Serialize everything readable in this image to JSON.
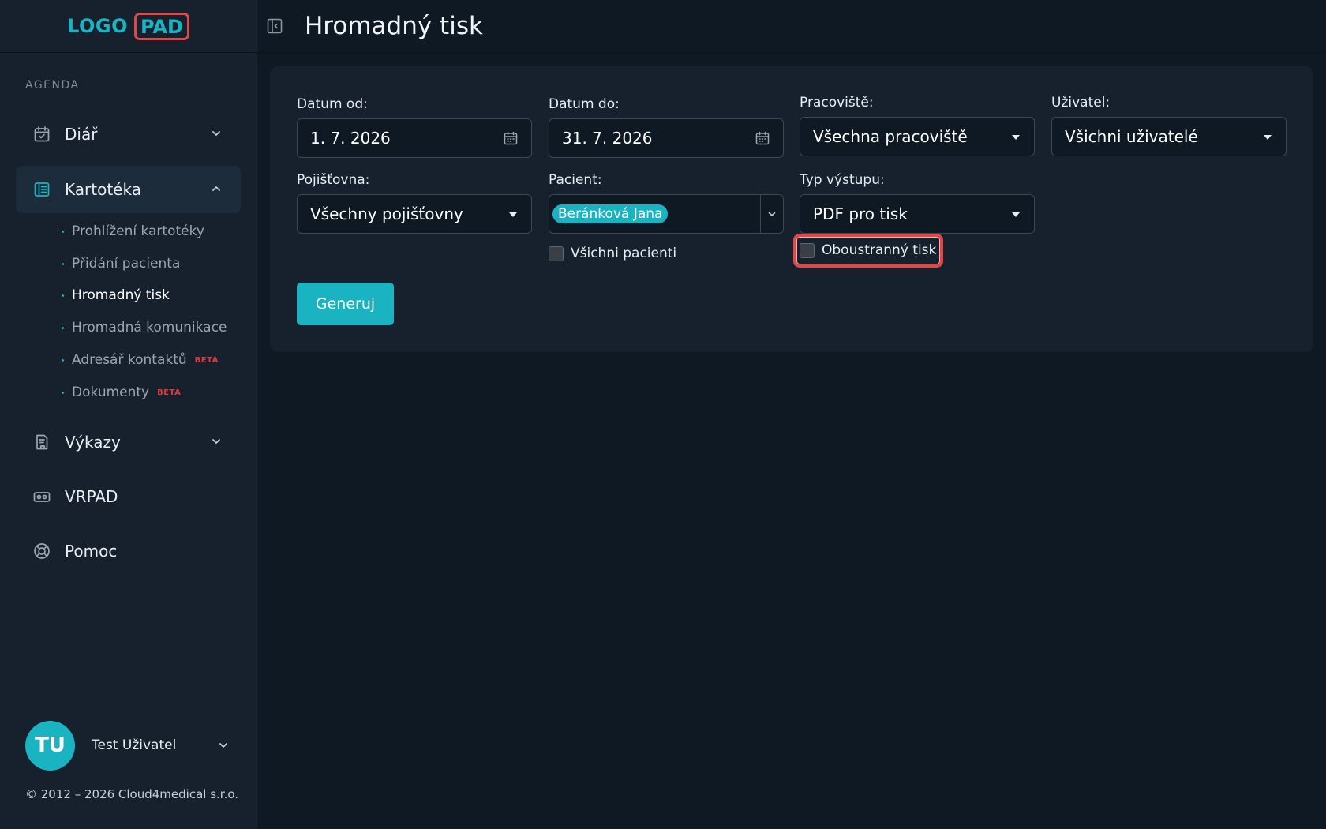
{
  "app": {
    "logo_text": "LOGO",
    "logo_badge": "PAD",
    "copyright": "© 2012 – 2026 Cloud4medical s.r.o."
  },
  "header": {
    "title": "Hromadný tisk"
  },
  "sidebar": {
    "section_label": "AGENDA",
    "items": [
      {
        "label": "Diář",
        "icon": "calendar-check-icon",
        "expanded": false
      },
      {
        "label": "Kartotéka",
        "icon": "card-index-icon",
        "expanded": true
      },
      {
        "label": "Výkazy",
        "icon": "report-icon",
        "expanded": false
      },
      {
        "label": "VRPAD",
        "icon": "vr-headset-icon"
      },
      {
        "label": "Pomoc",
        "icon": "lifebuoy-icon"
      }
    ],
    "subitems": [
      {
        "label": "Prohlížení kartotéky"
      },
      {
        "label": "Přidání pacienta"
      },
      {
        "label": "Hromadný tisk",
        "active": true
      },
      {
        "label": "Hromadná komunikace"
      },
      {
        "label": "Adresář kontaktů",
        "badge": "BETA"
      },
      {
        "label": "Dokumenty",
        "badge": "BETA"
      }
    ]
  },
  "user": {
    "initials": "TU",
    "name": "Test Uživatel"
  },
  "form": {
    "date_from": {
      "label": "Datum od:",
      "value": "1. 7. 2026"
    },
    "date_to": {
      "label": "Datum do:",
      "value": "31. 7. 2026"
    },
    "workplace": {
      "label": "Pracoviště:",
      "value": "Všechna pracoviště"
    },
    "user": {
      "label": "Uživatel:",
      "value": "Všichni uživatelé"
    },
    "insurance": {
      "label": "Pojišťovna:",
      "value": "Všechny pojišťovny"
    },
    "patient": {
      "label": "Pacient:",
      "chip": "Beránková Jana"
    },
    "all_patients": {
      "label": "Všichni pacienti",
      "checked": false
    },
    "output_type": {
      "label": "Typ výstupu:",
      "value": "PDF pro tisk"
    },
    "duplex": {
      "label": "Oboustranný tisk",
      "checked": false
    },
    "generate_button": "Generuj"
  },
  "colors": {
    "accent": "#19b3c2",
    "background": "#0f1923",
    "panel": "#16212d",
    "highlight": "#e04848",
    "beta": "#e03b3b"
  }
}
